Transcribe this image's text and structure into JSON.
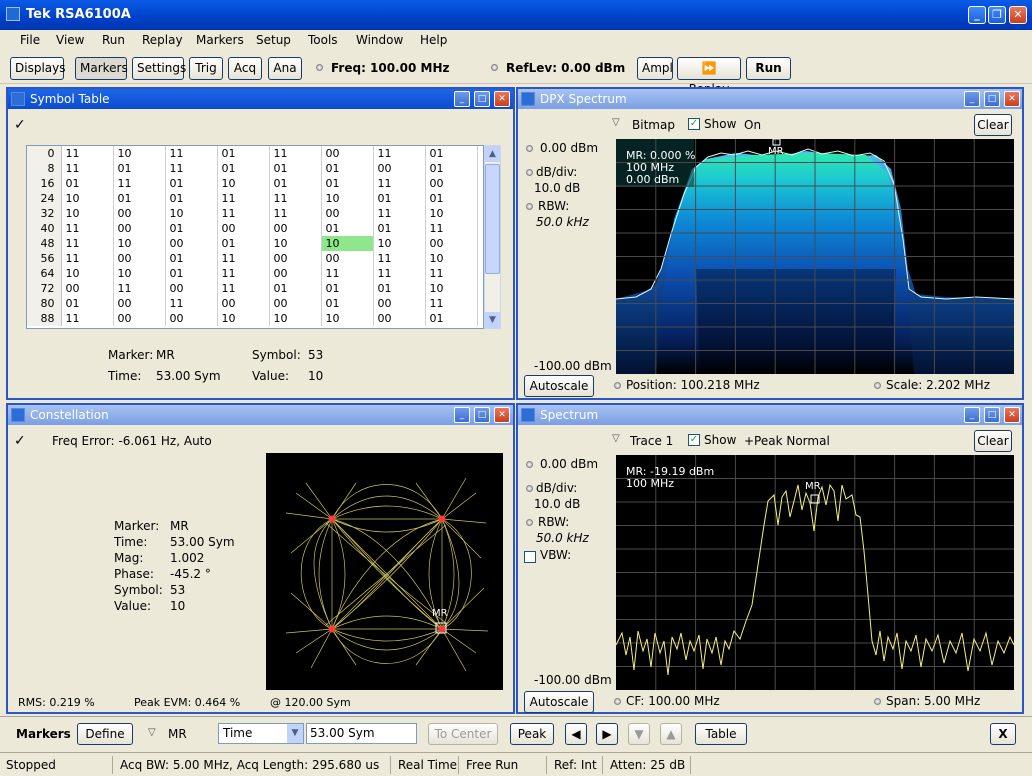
{
  "window": {
    "title": "Tek RSA6100A"
  },
  "menu": [
    "File",
    "View",
    "Run",
    "Replay",
    "Markers",
    "Setup",
    "Tools",
    "Window",
    "Help"
  ],
  "toolbar": {
    "displays": "Displays",
    "markers": "Markers",
    "settings": "Settings",
    "trig": "Trig",
    "acq": "Acq",
    "ana": "Ana",
    "freq": "Freq: 100.00 MHz",
    "reflev": "RefLev: 0.00 dBm",
    "ampl": "Ampl",
    "replay": "Replay",
    "run": "Run"
  },
  "symbol_table": {
    "title": "Symbol Table",
    "rows": [
      {
        "idx": "0",
        "v": [
          "11",
          "10",
          "11",
          "01",
          "11",
          "00",
          "11",
          "01"
        ]
      },
      {
        "idx": "8",
        "v": [
          "11",
          "01",
          "11",
          "01",
          "01",
          "01",
          "00",
          "01"
        ]
      },
      {
        "idx": "16",
        "v": [
          "01",
          "11",
          "01",
          "10",
          "01",
          "01",
          "11",
          "00"
        ]
      },
      {
        "idx": "24",
        "v": [
          "10",
          "01",
          "01",
          "11",
          "11",
          "10",
          "01",
          "01"
        ]
      },
      {
        "idx": "32",
        "v": [
          "10",
          "00",
          "10",
          "11",
          "11",
          "00",
          "11",
          "10"
        ]
      },
      {
        "idx": "40",
        "v": [
          "11",
          "00",
          "01",
          "00",
          "00",
          "01",
          "01",
          "11"
        ]
      },
      {
        "idx": "48",
        "v": [
          "11",
          "10",
          "00",
          "01",
          "10",
          "10",
          "10",
          "00"
        ]
      },
      {
        "idx": "56",
        "v": [
          "11",
          "00",
          "01",
          "11",
          "00",
          "00",
          "11",
          "10"
        ]
      },
      {
        "idx": "64",
        "v": [
          "10",
          "10",
          "01",
          "11",
          "00",
          "11",
          "11",
          "11"
        ]
      },
      {
        "idx": "72",
        "v": [
          "00",
          "11",
          "00",
          "11",
          "01",
          "01",
          "01",
          "10"
        ]
      },
      {
        "idx": "80",
        "v": [
          "01",
          "00",
          "11",
          "00",
          "00",
          "01",
          "00",
          "11"
        ]
      },
      {
        "idx": "88",
        "v": [
          "11",
          "00",
          "00",
          "10",
          "10",
          "10",
          "00",
          "01"
        ]
      }
    ],
    "marker_label": "Marker:",
    "marker_value": "MR",
    "symbol_label": "Symbol:",
    "symbol_value": "53",
    "time_label": "Time:",
    "time_value": "53.00 Sym",
    "value_label": "Value:",
    "value_value": "10"
  },
  "dpx": {
    "title": "DPX Spectrum",
    "mode": "Bitmap",
    "show": "Show",
    "on": "On",
    "clear": "Clear",
    "top": "0.00 dBm",
    "dbdiv_label": "dB/div:",
    "dbdiv": "10.0 dB",
    "rbw_label": "RBW:",
    "rbw": "50.0 kHz",
    "bottom": "-100.00 dBm",
    "readout": [
      "MR: 0.000 %",
      "100 MHz",
      "0.00 dBm"
    ],
    "marker": "MR",
    "autoscale": "Autoscale",
    "position": "Position: 100.218 MHz",
    "scale": "Scale: 2.202 MHz"
  },
  "constellation": {
    "title": "Constellation",
    "freq_error": "Freq Error: -6.061 Hz, Auto",
    "fields": [
      {
        "k": "Marker:",
        "v": "MR"
      },
      {
        "k": "Time:",
        "v": "53.00 Sym"
      },
      {
        "k": "Mag:",
        "v": "1.002"
      },
      {
        "k": "Phase:",
        "v": "-45.2 °"
      },
      {
        "k": "Symbol:",
        "v": "53"
      },
      {
        "k": "Value:",
        "v": "10"
      }
    ],
    "rms": "RMS:  0.219 %",
    "peak_evm": "Peak EVM:  0.464 %",
    "at": "@  120.00 Sym",
    "marker": "MR"
  },
  "spectrum": {
    "title": "Spectrum",
    "trace": "Trace 1",
    "show": "Show",
    "detector": "+Peak Normal",
    "clear": "Clear",
    "top": "0.00 dBm",
    "dbdiv_label": "dB/div:",
    "dbdiv": "10.0 dB",
    "rbw_label": "RBW:",
    "rbw": "50.0 kHz",
    "vbw_label": "VBW:",
    "bottom": "-100.00 dBm",
    "readout": [
      "MR: -19.19 dBm",
      "100 MHz"
    ],
    "marker": "MR",
    "autoscale": "Autoscale",
    "cf": "CF: 100.00 MHz",
    "span": "Span: 5.00 MHz"
  },
  "markers_bar": {
    "label": "Markers",
    "define": "Define",
    "marker": "MR",
    "select": "Time",
    "value": "53.00 Sym",
    "to_center": "To Center",
    "peak": "Peak",
    "table": "Table",
    "close": "X"
  },
  "status": {
    "state": "Stopped",
    "acq": "Acq BW: 5.00 MHz, Acq Length: 295.680 us",
    "mode": "Real Time",
    "run": "Free Run",
    "ref": "Ref: Int",
    "atten": "Atten: 25 dB"
  },
  "colors": {
    "title_active": "#0c4bd0",
    "trace": "#f6f07a",
    "dpx_hot": "#25d8a8",
    "highlight": "#8ee78a"
  }
}
